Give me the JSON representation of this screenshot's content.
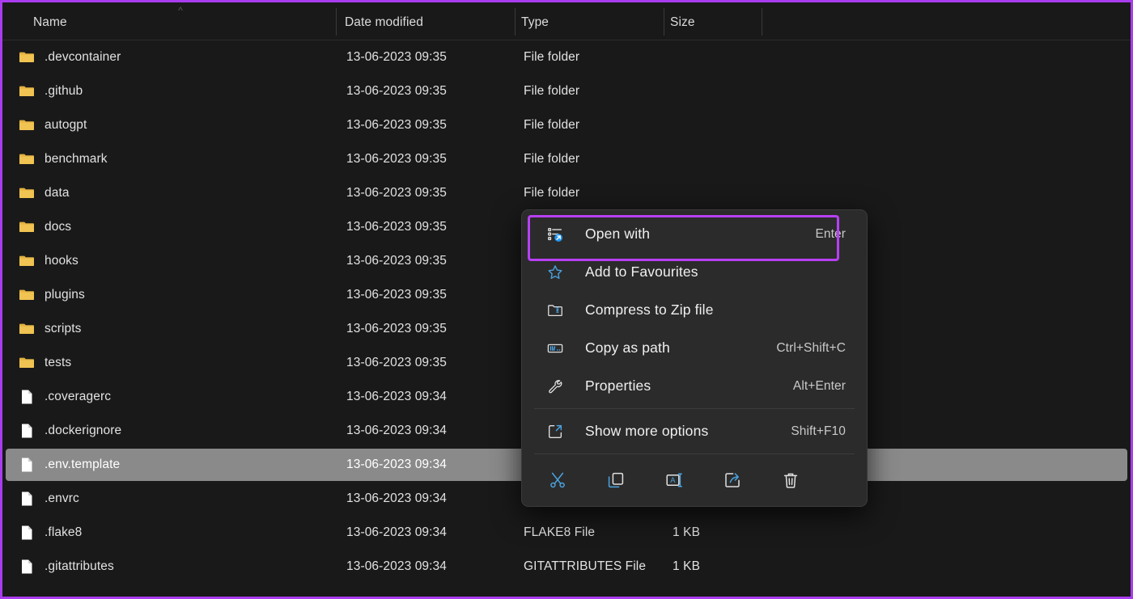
{
  "header": {
    "columns": [
      {
        "label": "Name",
        "sort_indicator": "ascending"
      },
      {
        "label": "Date modified"
      },
      {
        "label": "Type"
      },
      {
        "label": "Size"
      }
    ]
  },
  "file_list": {
    "rows": [
      {
        "icon": "folder-icon",
        "name": ".devcontainer",
        "date": "13-06-2023 09:35",
        "type": "File folder",
        "size": "",
        "selected": false
      },
      {
        "icon": "folder-icon",
        "name": ".github",
        "date": "13-06-2023 09:35",
        "type": "File folder",
        "size": "",
        "selected": false
      },
      {
        "icon": "folder-icon",
        "name": "autogpt",
        "date": "13-06-2023 09:35",
        "type": "File folder",
        "size": "",
        "selected": false
      },
      {
        "icon": "folder-icon",
        "name": "benchmark",
        "date": "13-06-2023 09:35",
        "type": "File folder",
        "size": "",
        "selected": false
      },
      {
        "icon": "folder-icon",
        "name": "data",
        "date": "13-06-2023 09:35",
        "type": "File folder",
        "size": "",
        "selected": false
      },
      {
        "icon": "folder-icon",
        "name": "docs",
        "date": "13-06-2023 09:35",
        "type": "File folder",
        "size": "",
        "selected": false
      },
      {
        "icon": "folder-icon",
        "name": "hooks",
        "date": "13-06-2023 09:35",
        "type": "File folder",
        "size": "",
        "selected": false
      },
      {
        "icon": "folder-icon",
        "name": "plugins",
        "date": "13-06-2023 09:35",
        "type": "File folder",
        "size": "",
        "selected": false
      },
      {
        "icon": "folder-icon",
        "name": "scripts",
        "date": "13-06-2023 09:35",
        "type": "File folder",
        "size": "",
        "selected": false
      },
      {
        "icon": "folder-icon",
        "name": "tests",
        "date": "13-06-2023 09:35",
        "type": "File folder",
        "size": "",
        "selected": false
      },
      {
        "icon": "file-icon",
        "name": ".coveragerc",
        "date": "13-06-2023 09:34",
        "type": "",
        "size": "",
        "selected": false
      },
      {
        "icon": "file-icon",
        "name": ".dockerignore",
        "date": "13-06-2023 09:34",
        "type": "",
        "size": "",
        "selected": false
      },
      {
        "icon": "file-icon",
        "name": ".env.template",
        "date": "13-06-2023 09:34",
        "type": "",
        "size": "",
        "selected": true
      },
      {
        "icon": "file-icon",
        "name": ".envrc",
        "date": "13-06-2023 09:34",
        "type": "",
        "size": "",
        "selected": false
      },
      {
        "icon": "file-icon",
        "name": ".flake8",
        "date": "13-06-2023 09:34",
        "type": "FLAKE8 File",
        "size": "1 KB",
        "selected": false
      },
      {
        "icon": "file-icon",
        "name": ".gitattributes",
        "date": "13-06-2023 09:34",
        "type": "GITATTRIBUTES File",
        "size": "1 KB",
        "selected": false
      }
    ]
  },
  "context_menu": {
    "items": [
      {
        "icon": "open-with-icon",
        "label": "Open with",
        "accel": "Enter",
        "highlighted": true
      },
      {
        "icon": "star-icon",
        "label": "Add to Favourites",
        "accel": "",
        "highlighted": false
      },
      {
        "icon": "zip-folder-icon",
        "label": "Compress to Zip file",
        "accel": "",
        "highlighted": false
      },
      {
        "icon": "copy-path-icon",
        "label": "Copy as path",
        "accel": "Ctrl+Shift+C",
        "highlighted": false
      },
      {
        "icon": "wrench-icon",
        "label": "Properties",
        "accel": "Alt+Enter",
        "highlighted": false
      },
      {
        "icon": "show-more-options-icon",
        "label": "Show more options",
        "accel": "Shift+F10",
        "highlighted": false
      }
    ],
    "toolbar": [
      {
        "icon": "cut-icon",
        "label": "Cut"
      },
      {
        "icon": "copy-icon",
        "label": "Copy"
      },
      {
        "icon": "rename-icon",
        "label": "Rename"
      },
      {
        "icon": "share-icon",
        "label": "Share"
      },
      {
        "icon": "delete-icon",
        "label": "Delete"
      }
    ]
  },
  "colors": {
    "annotation_purple": "#a93cee",
    "highlight_purple": "#b740f5",
    "folder_yellow": "#e3b341",
    "accent_blue": "#4aa3e0",
    "menu_background": "#2b2b2b",
    "window_background": "#191919",
    "selected_row": "#8a8a8a"
  }
}
